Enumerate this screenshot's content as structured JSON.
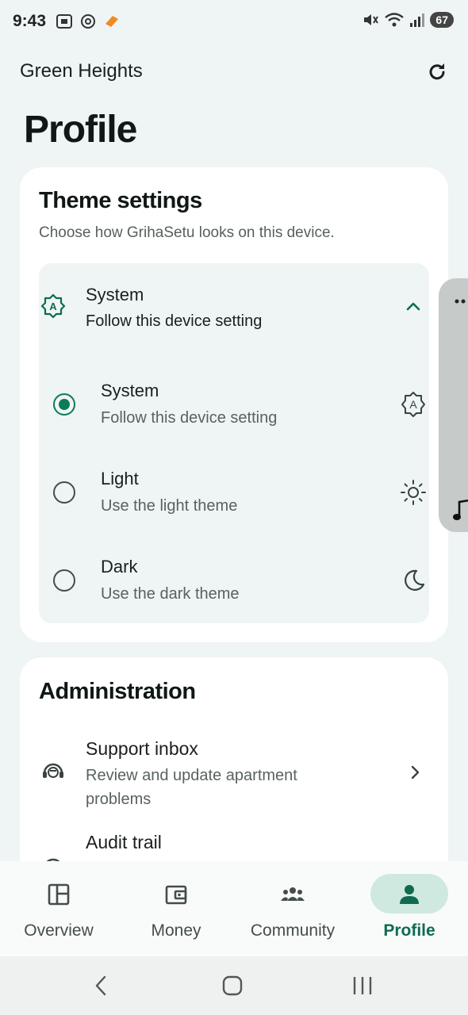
{
  "status": {
    "time": "9:43",
    "battery": "67",
    "wifi_badge": "6"
  },
  "app_bar": {
    "title": "Green Heights",
    "refresh_icon": "refresh-icon"
  },
  "page": {
    "title": "Profile"
  },
  "theme": {
    "title": "Theme settings",
    "subtitle": "Choose how GrihaSetu looks on this device.",
    "selected": {
      "title": "System",
      "subtitle": "Follow this device setting",
      "icon": "auto-theme-icon"
    },
    "options": [
      {
        "title": "System",
        "subtitle": "Follow this device setting",
        "icon": "auto-theme-icon",
        "checked": true
      },
      {
        "title": "Light",
        "subtitle": "Use the light theme",
        "icon": "sun-icon",
        "checked": false
      },
      {
        "title": "Dark",
        "subtitle": "Use the dark theme",
        "icon": "moon-icon",
        "checked": false
      }
    ]
  },
  "admin": {
    "title": "Administration",
    "items": [
      {
        "title": "Support inbox",
        "subtitle": "Review and update apartment problems",
        "icon": "support-agent-icon"
      },
      {
        "title": "Audit trail",
        "icon": "audit-icon"
      }
    ]
  },
  "nav": {
    "items": [
      {
        "label": "Overview",
        "icon": "dashboard-icon",
        "active": false
      },
      {
        "label": "Money",
        "icon": "wallet-icon",
        "active": false
      },
      {
        "label": "Community",
        "icon": "groups-icon",
        "active": false
      },
      {
        "label": "Profile",
        "icon": "person-icon",
        "active": true
      }
    ]
  },
  "colors": {
    "accent": "#0e7a5a",
    "background": "#eef5f4",
    "active_pill": "#cfe9e0"
  }
}
